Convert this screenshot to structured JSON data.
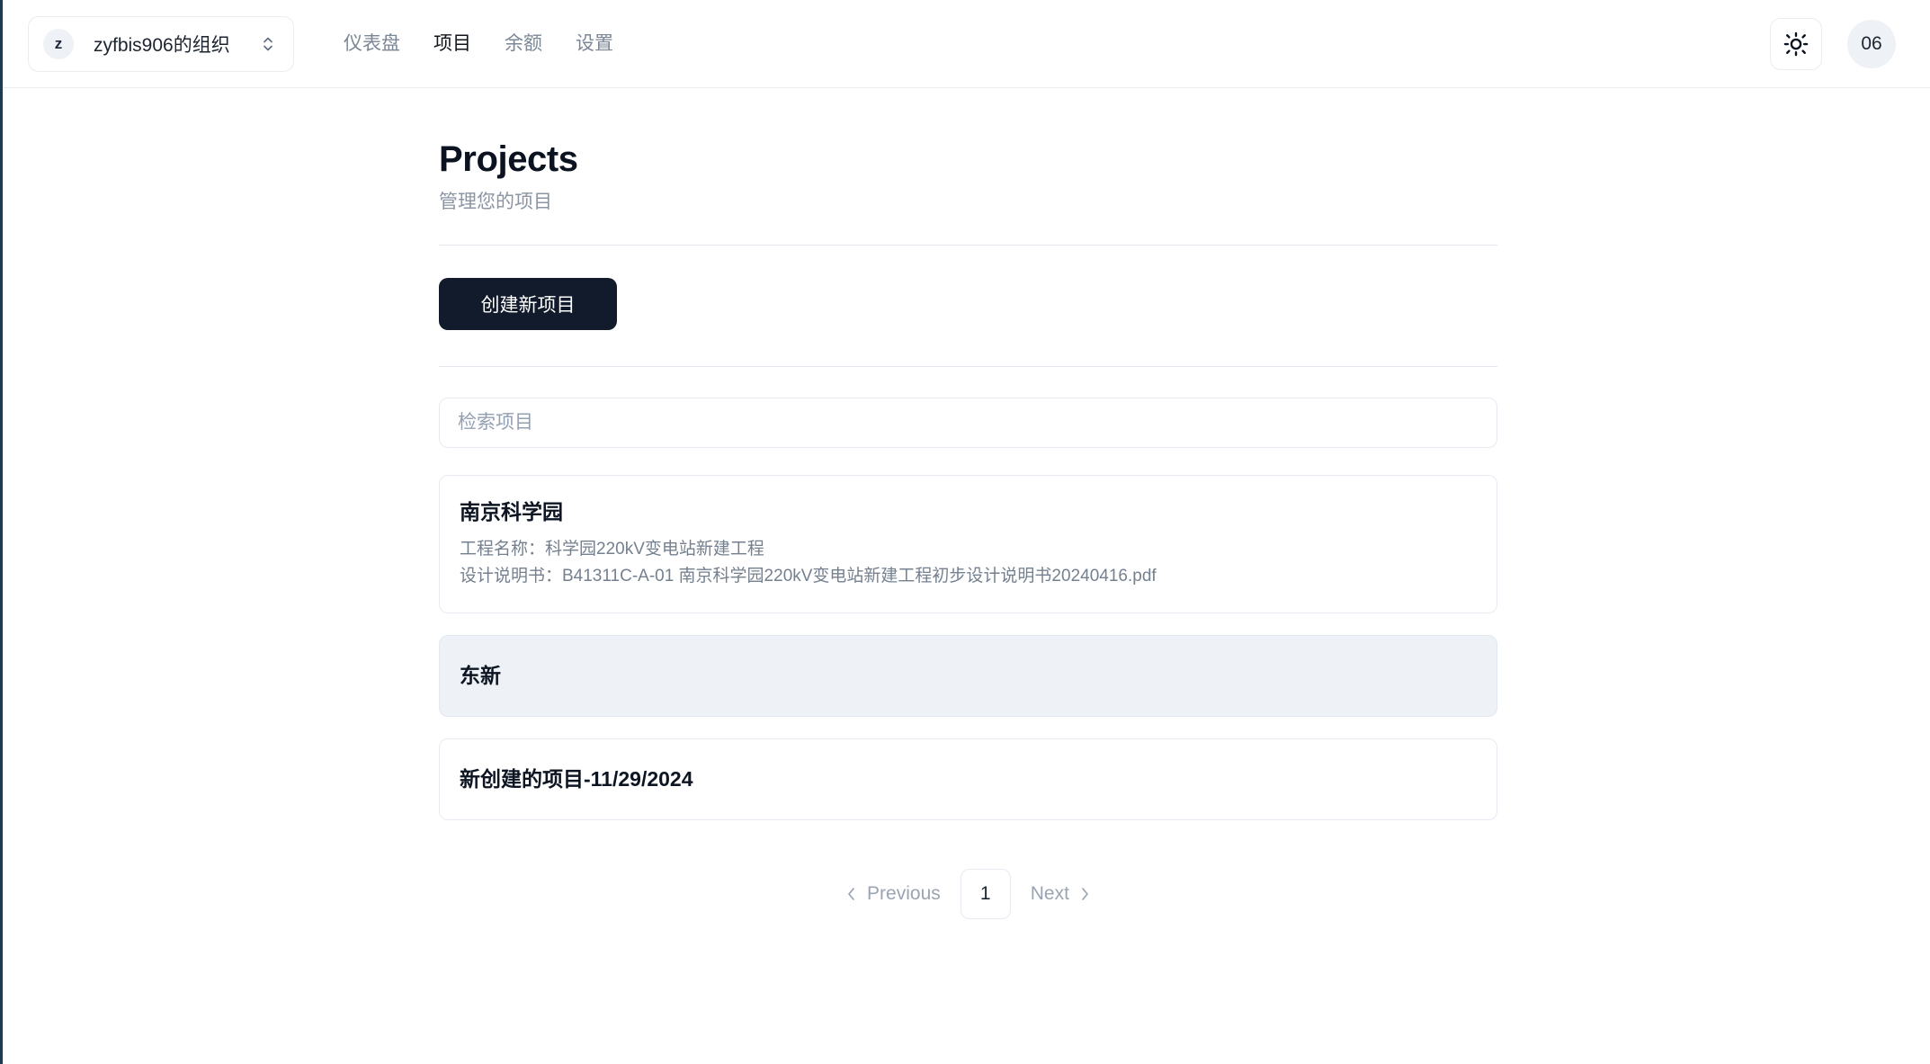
{
  "header": {
    "org": {
      "avatar_initial": "z",
      "name": "zyfbis906的组织",
      "chevron_icon": "chevron-up-down-icon"
    },
    "nav": [
      {
        "label": "仪表盘",
        "active": false
      },
      {
        "label": "项目",
        "active": true
      },
      {
        "label": "余额",
        "active": false
      },
      {
        "label": "设置",
        "active": false
      }
    ],
    "theme_toggle": {
      "icon": "sun-icon"
    },
    "user_avatar": {
      "label": "06"
    }
  },
  "main": {
    "title": "Projects",
    "subtitle": "管理您的项目",
    "create_button": "创建新项目",
    "search": {
      "placeholder": "检索项目",
      "value": ""
    },
    "projects": [
      {
        "name": "南京科学园",
        "meta": [
          "工程名称：科学园220kV变电站新建工程",
          "设计说明书：B41311C-A-01 南京科学园220kV变电站新建工程初步设计说明书20240416.pdf"
        ],
        "hovered": false
      },
      {
        "name": "东新",
        "meta": [],
        "hovered": true
      },
      {
        "name": "新创建的项目-11/29/2024",
        "meta": [],
        "hovered": false
      }
    ],
    "pagination": {
      "previous_label": "Previous",
      "current_page": "1",
      "next_label": "Next"
    }
  },
  "colors": {
    "primary_button": "#111b2b",
    "accent_text": "#0b1220",
    "muted_text": "#8a94a2",
    "card_hover_bg": "#eef2f7",
    "border": "#e7ebf1"
  }
}
